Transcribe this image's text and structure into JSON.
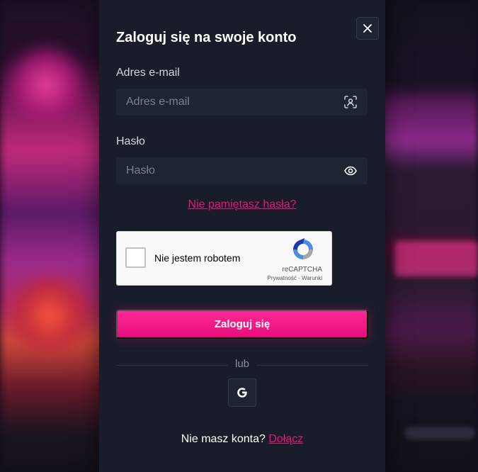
{
  "modal": {
    "title": "Zaloguj się na swoje konto",
    "close_icon": "close-icon"
  },
  "email": {
    "label": "Adres e-mail",
    "placeholder": "Adres e-mail",
    "value": "",
    "icon": "face-scan-icon"
  },
  "password": {
    "label": "Hasło",
    "placeholder": "Hasło",
    "value": "",
    "icon": "eye-icon"
  },
  "forgot_password": "Nie pamiętasz hasła?",
  "captcha": {
    "label": "Nie jestem robotem",
    "brand": "reCAPTCHA",
    "links": "Prywatność - Warunki",
    "checked": false
  },
  "login_button": "Zaloguj się",
  "divider": "lub",
  "google_button": {
    "icon": "google-icon"
  },
  "signup": {
    "prompt": "Nie masz konta?",
    "link": "Dołącz"
  },
  "colors": {
    "accent": "#e8157e",
    "modal_bg": "#191d29",
    "field_bg": "#1f2433"
  }
}
